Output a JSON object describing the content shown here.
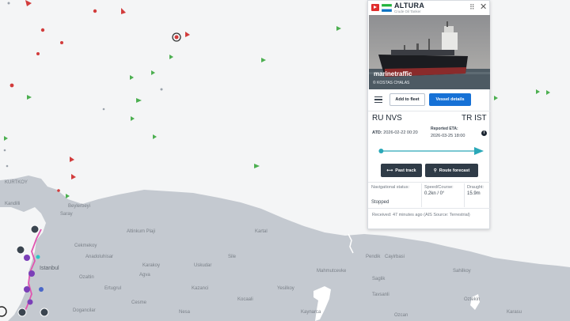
{
  "map": {
    "colors": {
      "sea": "#f4f5f6",
      "land": "#c4c9d0",
      "water_inland": "#ffffff",
      "vessel_green": "#4caf50",
      "vessel_red": "#d23c3c",
      "vessel_purple": "#7b3fb8",
      "route_pink": "#e056b0"
    },
    "place_labels": [
      "KURTKOY",
      "Kandilli",
      "Beylerbeyi",
      "Saray",
      "Altinkum Plaji",
      "Kartal",
      "Cekmekoy",
      "Sile",
      "Anadoluhisar",
      "Karakoy",
      "Uskudar",
      "Pendik",
      "Cayirbasi",
      "Mahmutcevke",
      "Saglik",
      "Sahilkoy",
      "Ozaltin",
      "Agva",
      "Ertugrul",
      "Kazanci",
      "Yesilkoy",
      "Tavsanli",
      "Oztekin",
      "Cesme",
      "Kocaali",
      "Dogancilar",
      "Nesa",
      "Kaynarca",
      "Ozcan",
      "Karasu"
    ],
    "city_label": "Istanbul"
  },
  "vessel_card": {
    "name": "ALTURA",
    "type": "Crude Oil Tanker",
    "flag_type_icon": "tanker-flag-icon",
    "photo_watermark": "marinetraffic",
    "photo_credit": "© KOSTAS CHALAS",
    "add_to_fleet_label": "Add to fleet",
    "vessel_details_label": "Vessel details",
    "port_from": "RU NVS",
    "port_to": "TR IST",
    "atd_label": "ATD:",
    "atd_value": "2026-02-22 00:20",
    "eta_label": "Reported ETA:",
    "eta_value": "2026-03-25 18:00",
    "past_track_label": "Past track",
    "route_forecast_label": "Route forecast",
    "nav_status_label": "Navigational status:",
    "nav_status_value": "Stopped",
    "speed_course_label": "Speed/Course:",
    "speed_course_value": "0.2kn / 0°",
    "draught_label": "Draught:",
    "draught_value": "15.9m",
    "received_text": "Received: 47 minutes ago (AIS Source: Terrestrial)",
    "route_progress": 0.02,
    "accent_color": "#1671d6"
  }
}
